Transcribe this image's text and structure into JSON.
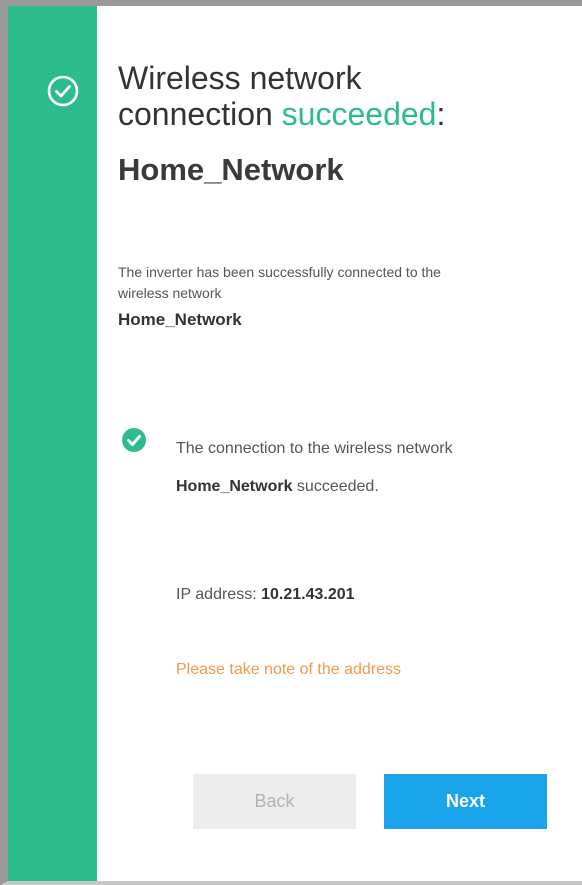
{
  "header": {
    "title_line1": "Wireless network",
    "title_line2_prefix": "connection ",
    "title_accent": "succeeded",
    "title_suffix": ":",
    "network_name": "Home_Network"
  },
  "description": {
    "text": "The inverter has been successfully connected to the wireless network",
    "network_name": "Home_Network"
  },
  "status": {
    "prefix": "The connection to the wireless network ",
    "network_name": "Home_Network",
    "suffix": " succeeded."
  },
  "ip": {
    "label": "IP address: ",
    "value": "10.21.43.201"
  },
  "note": "Please take note of the address",
  "buttons": {
    "back_label": "Back",
    "next_label": "Next"
  },
  "colors": {
    "accent": "#2dbd8c",
    "primary_button": "#1aa5ea",
    "note": "#f29a4a",
    "disabled_button": "#ededed"
  },
  "icons": {
    "sidebar": "check-circle-outline-icon",
    "status": "check-circle-filled-icon"
  }
}
